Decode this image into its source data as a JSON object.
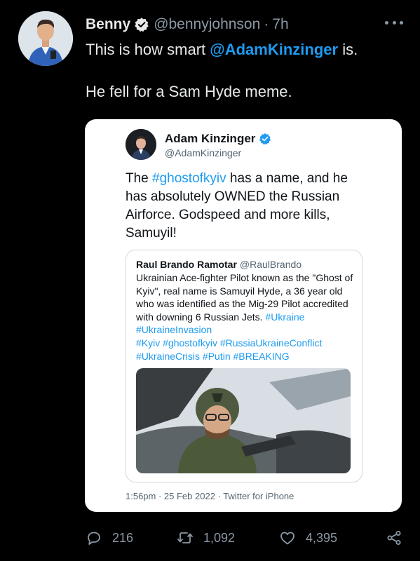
{
  "tweet": {
    "author_name": "Benny",
    "handle": "@bennyjohnson",
    "separator": "·",
    "time": "7h",
    "text_line1_prefix": "This is how smart ",
    "text_line1_mention": "@AdamKinzinger",
    "text_line1_suffix": " is.",
    "text_line2": "He fell for a Sam Hyde meme.",
    "icons": {
      "verified": "verified-badge-icon",
      "more": "more-options-icon"
    }
  },
  "embedded": {
    "author_name": "Adam Kinzinger",
    "handle": "@AdamKinzinger",
    "text_before": "The ",
    "hashtag": "#ghostofkyiv",
    "text_after": " has a name, and he has absolutely OWNED the Russian Airforce.  Godspeed and more kills, Samuyil!",
    "quoted": {
      "author_name": "Raul Brando Ramotar",
      "handle": "@RaulBrando",
      "text": "Ukrainian Ace-fighter Pilot known as the \"Ghost of Kyiv\", real name is Samuyil Hyde, a 36 year old who was identified as the Mig-29 Pilot accredited with downing 6 Russian Jets.",
      "hashtags_1": " #Ukraine #UkraineInvasion",
      "hashtags_2": "#Kyiv #ghostofkyiv #RussiaUkraineConflict",
      "hashtags_3": "#UkraineCrisis #Putin #BREAKING",
      "image": "pilot-in-cockpit-image"
    },
    "meta": "1:56pm · 25 Feb 2022 · Twitter for iPhone"
  },
  "actions": {
    "reply_count": "216",
    "retweet_count": "1,092",
    "like_count": "4,395",
    "icons": [
      "reply-icon",
      "retweet-icon",
      "like-icon",
      "share-icon"
    ]
  },
  "colors": {
    "background": "#000000",
    "text": "#e7e9ea",
    "secondary": "#8b98a5",
    "accent": "#1d9bf0",
    "card": "#ffffff"
  }
}
